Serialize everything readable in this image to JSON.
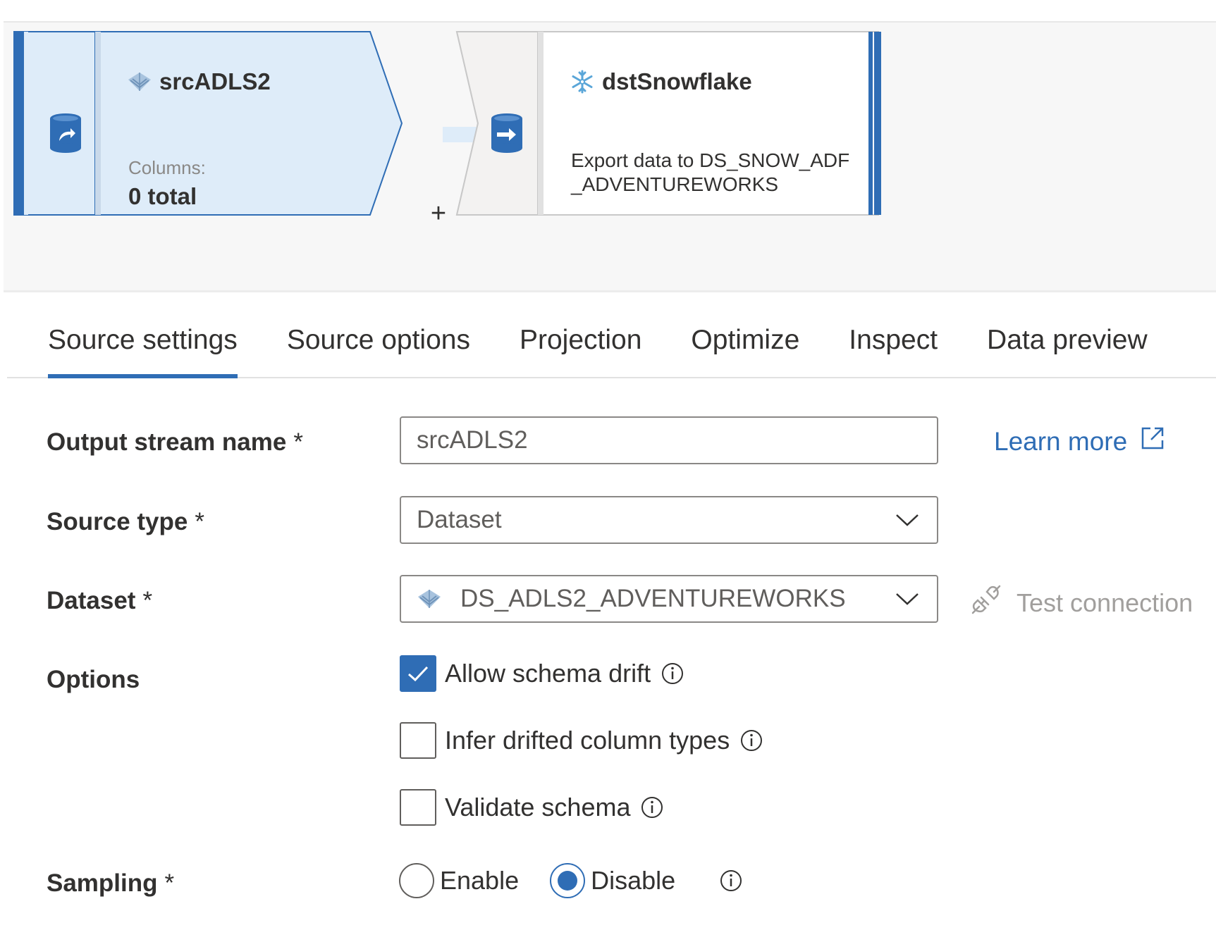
{
  "flow": {
    "source": {
      "name": "srcADLS2",
      "columns_label": "Columns:",
      "columns_value": "0 total"
    },
    "sink": {
      "name": "dstSnowflake",
      "description": "Export data to DS_SNOW_ADF_ADVENTUREWORKS"
    },
    "add_label": "+"
  },
  "tabs": [
    {
      "label": "Source settings",
      "active": true
    },
    {
      "label": "Source options",
      "active": false
    },
    {
      "label": "Projection",
      "active": false
    },
    {
      "label": "Optimize",
      "active": false
    },
    {
      "label": "Inspect",
      "active": false
    },
    {
      "label": "Data preview",
      "active": false
    }
  ],
  "form": {
    "output_stream": {
      "label": "Output stream name",
      "required": "*",
      "value": "srcADLS2"
    },
    "source_type": {
      "label": "Source type",
      "required": "*",
      "value": "Dataset"
    },
    "dataset": {
      "label": "Dataset",
      "required": "*",
      "value": "DS_ADLS2_ADVENTUREWORKS"
    },
    "options": {
      "label": "Options",
      "allow_schema_drift": {
        "label": "Allow schema drift",
        "checked": true
      },
      "infer_drifted": {
        "label": "Infer drifted column types",
        "checked": false
      },
      "validate_schema": {
        "label": "Validate schema",
        "checked": false
      }
    },
    "sampling": {
      "label": "Sampling",
      "required": "*",
      "enable": "Enable",
      "disable": "Disable",
      "selected": "Disable"
    },
    "learn_more": "Learn more",
    "test_connection": "Test connection"
  },
  "colors": {
    "accent": "#2f6db5",
    "node_fill": "#deecf9",
    "text": "#323130",
    "muted": "#8a8886"
  },
  "icons": [
    "database-icon",
    "datalake-icon",
    "snowflake-icon",
    "chevron-down-icon",
    "external-link-icon",
    "plug-icon",
    "checkmark-icon",
    "info-icon"
  ]
}
